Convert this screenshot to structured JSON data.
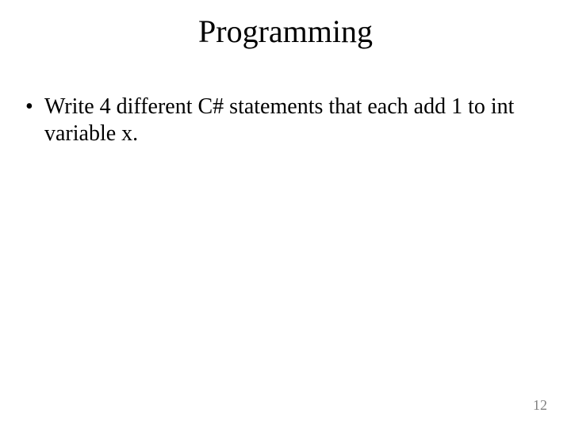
{
  "title": "Programming",
  "bullets": [
    "Write 4 different C# statements that each add 1 to int variable x."
  ],
  "page_number": "12"
}
